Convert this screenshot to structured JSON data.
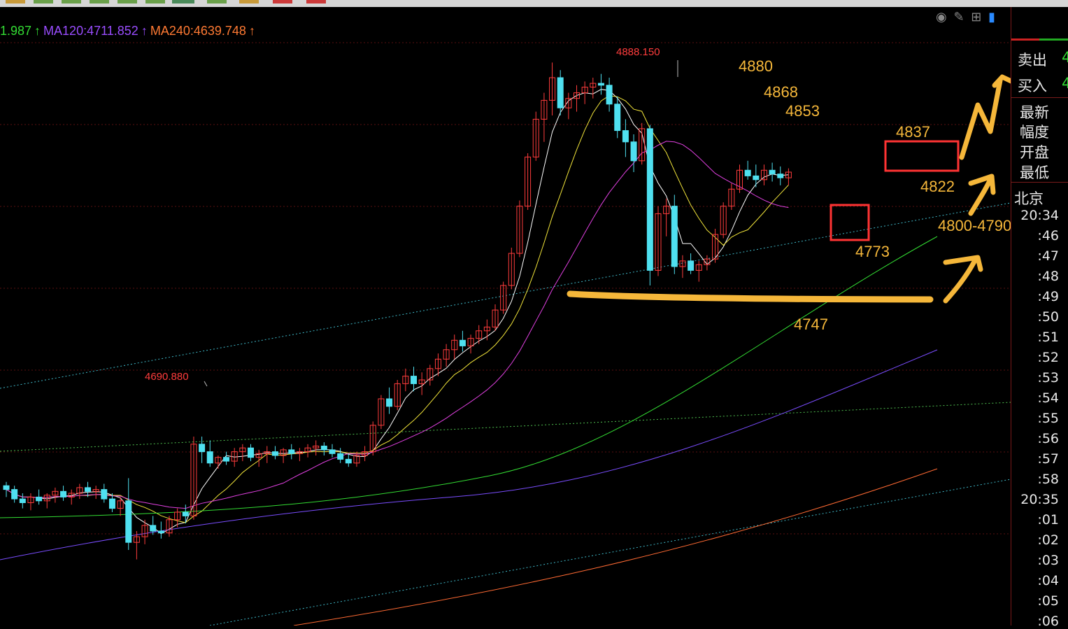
{
  "legend": {
    "ma60": "1.987",
    "ma120": "MA120:4711.852",
    "ma240": "MA240:4639.748",
    "arrow": "↑",
    "colors": {
      "ma60": "#33dd33",
      "ma120": "#9a4dff",
      "ma240": "#ff7a33"
    }
  },
  "peak_labels": {
    "high": "4888.150",
    "low_high": "4690.880"
  },
  "annotations": {
    "a4880": "4880",
    "a4868": "4868",
    "a4853": "4853",
    "a4837": "4837",
    "a4822": "4822",
    "a4773": "4773",
    "a4747": "4747",
    "a4800": "4800-4790"
  },
  "right_panel": {
    "sell": "卖出",
    "buy": "买入",
    "sell_val": "4",
    "buy_val": "4",
    "latest": "最新",
    "amplitude": "幅度",
    "open": "开盘",
    "low": "最低",
    "beijing": "北京",
    "times": [
      "20:34",
      ":46",
      ":47",
      ":48",
      ":49",
      ":50",
      ":51",
      ":52",
      ":53",
      ":54",
      ":55",
      ":56",
      ":57",
      ":58",
      "20:35",
      ":01",
      ":02",
      ":03",
      ":04",
      ":05",
      ":06"
    ]
  },
  "chart_data": {
    "type": "candlestick",
    "ylim": [
      4590,
      4910
    ],
    "series": [
      {
        "name": "MA120",
        "value": 4711.852
      },
      {
        "name": "MA240",
        "value": 4639.748
      }
    ],
    "candles": [
      [
        4664,
        4666,
        4658,
        4662
      ],
      [
        4662,
        4664,
        4655,
        4657
      ],
      [
        4657,
        4660,
        4652,
        4655
      ],
      [
        4655,
        4660,
        4651,
        4658
      ],
      [
        4658,
        4662,
        4654,
        4656
      ],
      [
        4656,
        4660,
        4652,
        4659
      ],
      [
        4659,
        4663,
        4655,
        4661
      ],
      [
        4661,
        4664,
        4656,
        4658
      ],
      [
        4658,
        4662,
        4654,
        4660
      ],
      [
        4660,
        4665,
        4657,
        4663
      ],
      [
        4663,
        4666,
        4658,
        4661
      ],
      [
        4661,
        4664,
        4657,
        4662
      ],
      [
        4662,
        4665,
        4655,
        4657
      ],
      [
        4657,
        4660,
        4650,
        4652
      ],
      [
        4652,
        4658,
        4648,
        4656
      ],
      [
        4656,
        4668,
        4630,
        4634
      ],
      [
        4634,
        4640,
        4625,
        4637
      ],
      [
        4637,
        4646,
        4633,
        4643
      ],
      [
        4643,
        4648,
        4638,
        4640
      ],
      [
        4640,
        4645,
        4636,
        4639
      ],
      [
        4639,
        4648,
        4637,
        4646
      ],
      [
        4646,
        4652,
        4642,
        4650
      ],
      [
        4650,
        4654,
        4644,
        4648
      ],
      [
        4648,
        4690,
        4646,
        4686
      ],
      [
        4686,
        4690,
        4676,
        4682
      ],
      [
        4682,
        4688,
        4674,
        4676
      ],
      [
        4676,
        4680,
        4673,
        4679
      ],
      [
        4679,
        4682,
        4675,
        4677
      ],
      [
        4677,
        4684,
        4674,
        4682
      ],
      [
        4682,
        4686,
        4677,
        4684
      ],
      [
        4684,
        4686,
        4677,
        4679
      ],
      [
        4679,
        4683,
        4674,
        4681
      ],
      [
        4681,
        4685,
        4676,
        4682
      ],
      [
        4682,
        4685,
        4678,
        4680
      ],
      [
        4680,
        4684,
        4676,
        4683
      ],
      [
        4683,
        4686,
        4678,
        4681
      ],
      [
        4681,
        4684,
        4677,
        4682
      ],
      [
        4682,
        4686,
        4679,
        4684
      ],
      [
        4684,
        4688,
        4680,
        4685
      ],
      [
        4685,
        4687,
        4680,
        4683
      ],
      [
        4683,
        4686,
        4679,
        4681
      ],
      [
        4681,
        4684,
        4676,
        4678
      ],
      [
        4678,
        4681,
        4674,
        4676
      ],
      [
        4676,
        4682,
        4674,
        4680
      ],
      [
        4680,
        4685,
        4677,
        4682
      ],
      [
        4682,
        4698,
        4680,
        4696
      ],
      [
        4696,
        4712,
        4694,
        4710
      ],
      [
        4710,
        4716,
        4702,
        4706
      ],
      [
        4706,
        4720,
        4704,
        4718
      ],
      [
        4718,
        4726,
        4714,
        4722
      ],
      [
        4722,
        4727,
        4714,
        4718
      ],
      [
        4718,
        4724,
        4712,
        4720
      ],
      [
        4720,
        4728,
        4717,
        4726
      ],
      [
        4726,
        4734,
        4722,
        4731
      ],
      [
        4731,
        4739,
        4727,
        4736
      ],
      [
        4736,
        4744,
        4731,
        4741
      ],
      [
        4741,
        4746,
        4735,
        4738
      ],
      [
        4738,
        4744,
        4734,
        4742
      ],
      [
        4742,
        4749,
        4739,
        4746
      ],
      [
        4746,
        4752,
        4741,
        4748
      ],
      [
        4748,
        4760,
        4746,
        4757
      ],
      [
        4757,
        4772,
        4755,
        4770
      ],
      [
        4770,
        4790,
        4768,
        4787
      ],
      [
        4787,
        4815,
        4785,
        4812
      ],
      [
        4812,
        4840,
        4810,
        4838
      ],
      [
        4838,
        4862,
        4836,
        4858
      ],
      [
        4858,
        4872,
        4846,
        4868
      ],
      [
        4868,
        4888,
        4860,
        4880
      ],
      [
        4880,
        4884,
        4860,
        4864
      ],
      [
        4864,
        4872,
        4858,
        4869
      ],
      [
        4869,
        4876,
        4862,
        4872
      ],
      [
        4872,
        4878,
        4866,
        4875
      ],
      [
        4875,
        4880,
        4869,
        4877
      ],
      [
        4877,
        4882,
        4871,
        4876
      ],
      [
        4876,
        4880,
        4862,
        4866
      ],
      [
        4866,
        4870,
        4848,
        4852
      ],
      [
        4852,
        4858,
        4838,
        4846
      ],
      [
        4846,
        4850,
        4830,
        4836
      ],
      [
        4836,
        4856,
        4834,
        4853
      ],
      [
        4853,
        4855,
        4770,
        4778
      ],
      [
        4778,
        4812,
        4775,
        4808
      ],
      [
        4808,
        4816,
        4796,
        4812
      ],
      [
        4812,
        4818,
        4776,
        4780
      ],
      [
        4780,
        4786,
        4774,
        4783
      ],
      [
        4783,
        4787,
        4776,
        4778
      ],
      [
        4778,
        4783,
        4772,
        4781
      ],
      [
        4781,
        4786,
        4778,
        4784
      ],
      [
        4784,
        4800,
        4782,
        4797
      ],
      [
        4797,
        4814,
        4795,
        4812
      ],
      [
        4812,
        4824,
        4810,
        4821
      ],
      [
        4821,
        4834,
        4819,
        4831
      ],
      [
        4831,
        4836,
        4826,
        4828
      ],
      [
        4828,
        4834,
        4822,
        4826
      ],
      [
        4826,
        4834,
        4823,
        4831
      ],
      [
        4831,
        4835,
        4825,
        4829
      ],
      [
        4829,
        4833,
        4823,
        4827
      ],
      [
        4827,
        4832,
        4823,
        4830
      ]
    ]
  }
}
